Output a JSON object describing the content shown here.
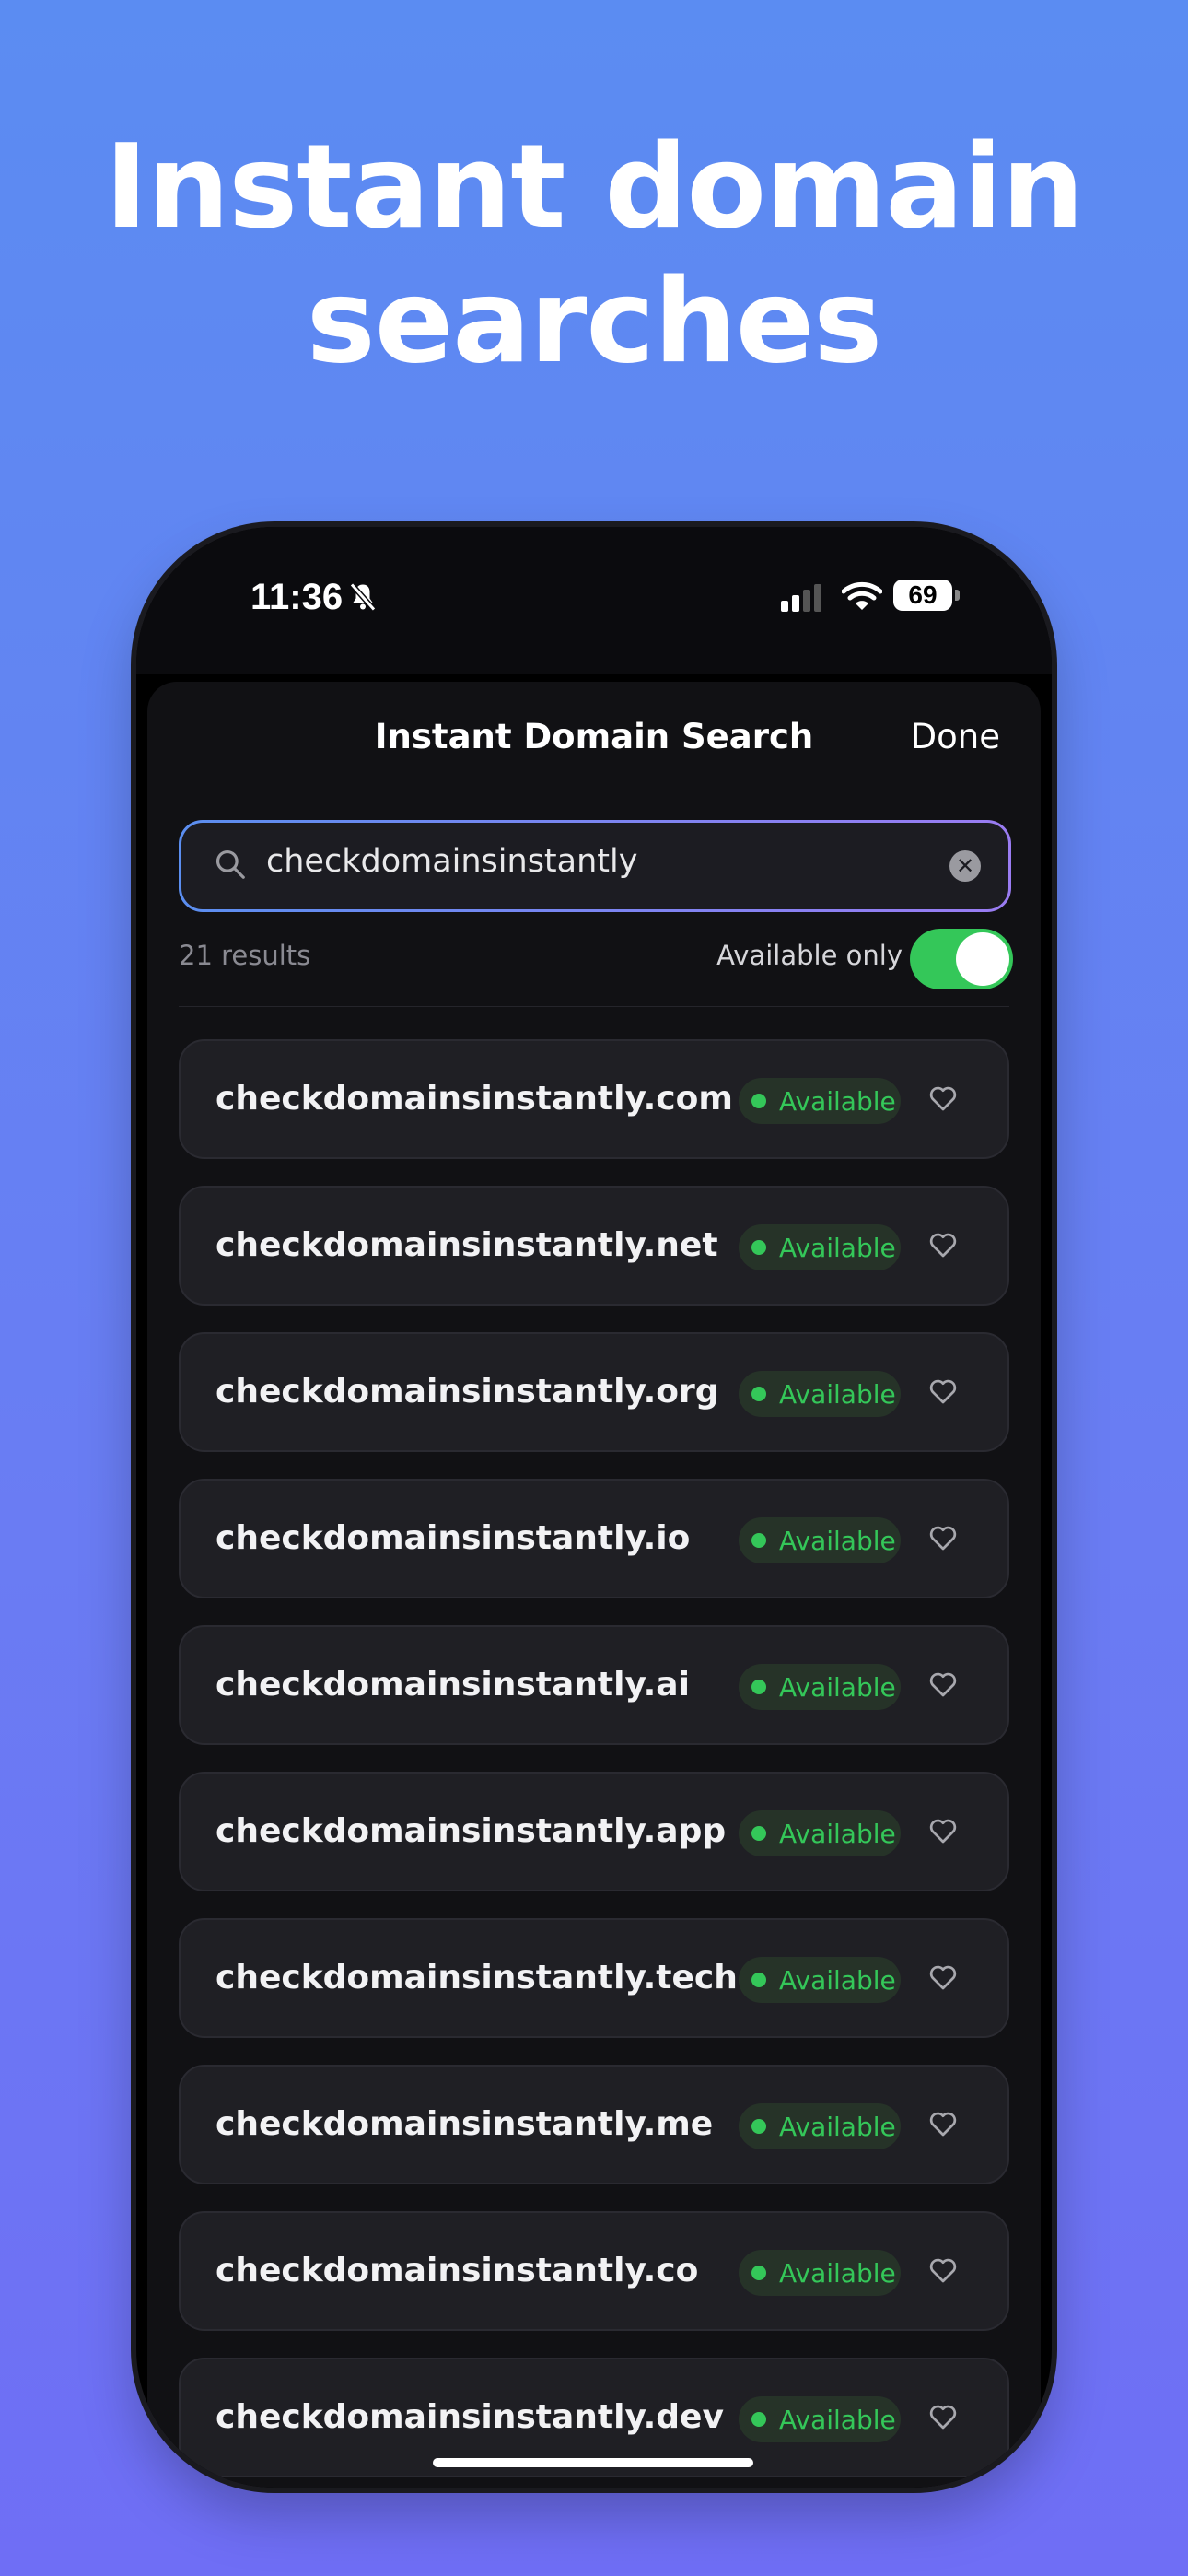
{
  "marketing": {
    "headline_line1": "Instant domain",
    "headline_line2": "searches"
  },
  "status_bar": {
    "time": "11:36",
    "battery": "69"
  },
  "nav": {
    "title": "Instant Domain Search",
    "done_label": "Done"
  },
  "search": {
    "query": "checkdomainsinstantly"
  },
  "filters": {
    "result_count": "21 results",
    "available_only_label": "Available only",
    "available_only_on": true
  },
  "results": [
    {
      "domain": "checkdomainsinstantly.com",
      "status": "Available"
    },
    {
      "domain": "checkdomainsinstantly.net",
      "status": "Available"
    },
    {
      "domain": "checkdomainsinstantly.org",
      "status": "Available"
    },
    {
      "domain": "checkdomainsinstantly.io",
      "status": "Available"
    },
    {
      "domain": "checkdomainsinstantly.ai",
      "status": "Available"
    },
    {
      "domain": "checkdomainsinstantly.app",
      "status": "Available"
    },
    {
      "domain": "checkdomainsinstantly.tech",
      "status": "Available"
    },
    {
      "domain": "checkdomainsinstantly.me",
      "status": "Available"
    },
    {
      "domain": "checkdomainsinstantly.co",
      "status": "Available"
    },
    {
      "domain": "checkdomainsinstantly.dev",
      "status": "Available"
    }
  ],
  "colors": {
    "accent_green": "#34c759",
    "background_top": "#5b8cf2",
    "background_bottom": "#6f6ef5"
  },
  "icons": [
    "bell-slash-icon",
    "signal-icon",
    "wifi-icon",
    "battery-icon",
    "search-icon",
    "clear-icon",
    "heart-icon"
  ]
}
